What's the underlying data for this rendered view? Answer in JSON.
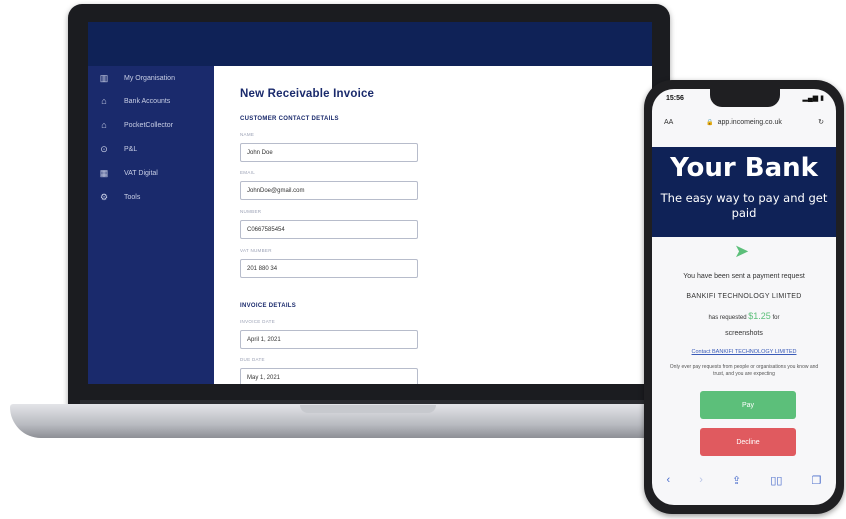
{
  "laptop": {
    "sidebar": {
      "items": [
        {
          "label": "My Organisation",
          "icon": "building-icon"
        },
        {
          "label": "Bank Accounts",
          "icon": "bank-icon"
        },
        {
          "label": "PocketCollector",
          "icon": "wallet-icon"
        },
        {
          "label": "P&L",
          "icon": "pound-icon"
        },
        {
          "label": "VAT Digital",
          "icon": "calendar-icon"
        },
        {
          "label": "Tools",
          "icon": "gear-icon"
        }
      ]
    },
    "form": {
      "title": "New Receivable Invoice",
      "customer_section": "CUSTOMER CONTACT DETAILS",
      "fields": [
        {
          "label": "NAME",
          "value": "John Doe"
        },
        {
          "label": "EMAIL",
          "value": "JohnDoe@gmail.com"
        },
        {
          "label": "NUMBER",
          "value": "C0667585454"
        },
        {
          "label": "VAT NUMBER",
          "value": "201 880 34"
        }
      ],
      "invoice_section": "INVOICE DETAILS",
      "invoice_fields": [
        {
          "label": "INVOICE DATE",
          "value": "April 1, 2021"
        },
        {
          "label": "DUE DATE",
          "value": "May 1, 2021"
        }
      ]
    }
  },
  "phone": {
    "time": "15:56",
    "url": "app.incomeing.co.uk",
    "url_left": "AA",
    "bank_title": "Your Bank",
    "bank_tagline": "The easy way to pay and get paid",
    "request_text": "You have been sent a payment request",
    "company": "BANKIFI TECHNOLOGY LIMITED",
    "requested_prefix": "has requested",
    "amount": "$1.25",
    "requested_suffix": "for",
    "reference": "screenshots",
    "contact_link": "Contact BANKIFI TECHNOLOGY LIMITED",
    "disclaimer": "Only ever pay requests from people or organisations you know and trust, and you are expecting",
    "pay_label": "Pay",
    "decline_label": "Decline",
    "colors": {
      "pay": "#5cbf7a",
      "decline": "#e05a5f",
      "header": "#0f2257"
    }
  }
}
